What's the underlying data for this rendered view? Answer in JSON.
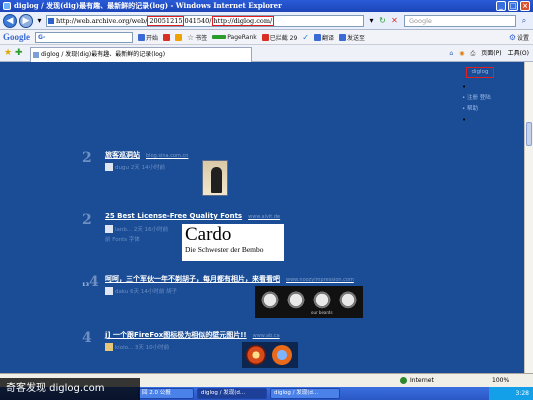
{
  "window": {
    "title": "diglog / 发现(dig)最有趣、最新鲜的记录(log) - Windows Internet Explorer",
    "buttons": [
      "_",
      "□",
      "×"
    ]
  },
  "address_bar": {
    "url_prefix": "http://web.archive.org/web/",
    "url_highlight_ts": "20051215",
    "url_middle": "041540/",
    "url_highlight_site": "http://diglog.com/",
    "search_placeholder": "Google"
  },
  "google_toolbar": {
    "logo": "Google",
    "search_value": "G-",
    "items": [
      {
        "label": "开始",
        "icon": "go-icon",
        "color": "#3a6ad6"
      },
      {
        "label": "",
        "icon": "gmail-icon",
        "color": "#d93025"
      },
      {
        "label": "",
        "icon": "bookmark-flag-icon",
        "color": "#f2a200"
      },
      {
        "label": "书签",
        "icon": "star-icon",
        "color": "#6c6c6c"
      },
      {
        "label": "PageRank",
        "icon": "pagerank-icon",
        "color": "#2a9c2a"
      },
      {
        "label": "已拦截 29",
        "icon": "popup-block-icon",
        "color": "#d93025"
      },
      {
        "label": "",
        "icon": "check-icon",
        "color": "#2a7ad6"
      },
      {
        "label": "翻译",
        "icon": "translate-icon",
        "color": "#3a6ad6"
      },
      {
        "label": "发送至",
        "icon": "send-icon",
        "color": "#3a6ad6"
      },
      {
        "label": "设置",
        "icon": "settings-icon",
        "color": "#3a6ad6"
      }
    ]
  },
  "tabs": {
    "active_label": "diglog / 发现(dig)最有趣、最新鲜的记录(log)",
    "commands": [
      "页面(P)",
      "工具(O)"
    ]
  },
  "page": {
    "top_chip": "diglog",
    "sidebar": [
      "注册",
      "登陆",
      "帮助"
    ],
    "entries": [
      {
        "rank": "2",
        "votes": "",
        "title": "旅客巡洞站",
        "source": "blog.sina.com.cn",
        "meta": "dugu 2天 14小时前"
      },
      {
        "rank": "2",
        "votes": "",
        "title": "25 Best License-Free Quality Fonts",
        "source": "www.alvit.de",
        "meta": "lanb... 2天 16小时前",
        "meta2": "前 Fonts 字体",
        "image_text_big": "Cardo",
        "image_text_small": "Die Schwester der Bembo"
      },
      {
        "rank": "4",
        "votes": "13",
        "title": "呵呵，三个军伙一年不剃胡子，每月都有相片，来看看吧",
        "source": "www.noozyimpression.com",
        "meta": "daku 6天 14小时前 胡子",
        "image_caption": "our beards"
      },
      {
        "rank": "4",
        "votes": "",
        "title": "j] 一个跟FireFox图标极为相似的壁元图片!!",
        "source": "www.ab.ca",
        "meta": "kiolo... 3天 10小时前"
      }
    ]
  },
  "status_bar": {
    "zone": "Internet",
    "zoom": "100%"
  },
  "taskbar": {
    "buttons": [
      "回 2.0 公报",
      "diglog / 发现(d...",
      "diglog / 发现(d..."
    ],
    "clock": "3:28"
  },
  "watermark": "奇客发现 diglog.com"
}
